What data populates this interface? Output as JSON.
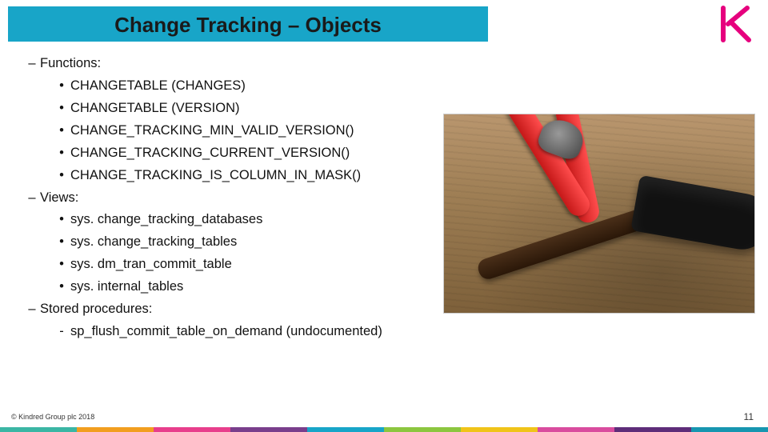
{
  "title": "Change Tracking – Objects",
  "sections": [
    {
      "label": "Functions:",
      "items": [
        "CHANGETABLE (CHANGES)",
        "CHANGETABLE (VERSION)",
        "CHANGE_TRACKING_MIN_VALID_VERSION()",
        "CHANGE_TRACKING_CURRENT_VERSION()",
        "CHANGE_TRACKING_IS_COLUMN_IN_MASK()"
      ]
    },
    {
      "label": "Views:",
      "items": [
        "sys. change_tracking_databases",
        "sys. change_tracking_tables",
        "sys. dm_tran_commit_table",
        "sys. internal_tables"
      ]
    },
    {
      "label": "Stored procedures:",
      "items": [
        "sp_flush_commit_table_on_demand (undocumented)"
      ]
    }
  ],
  "footer": {
    "copyright": "© Kindred Group plc 2018",
    "page": "11"
  },
  "colors": {
    "title_bar": "#18a5c8",
    "brand_magenta": "#e6007e"
  },
  "image": {
    "description": "Red-handled pliers and a hammer on a wooden workbench"
  }
}
